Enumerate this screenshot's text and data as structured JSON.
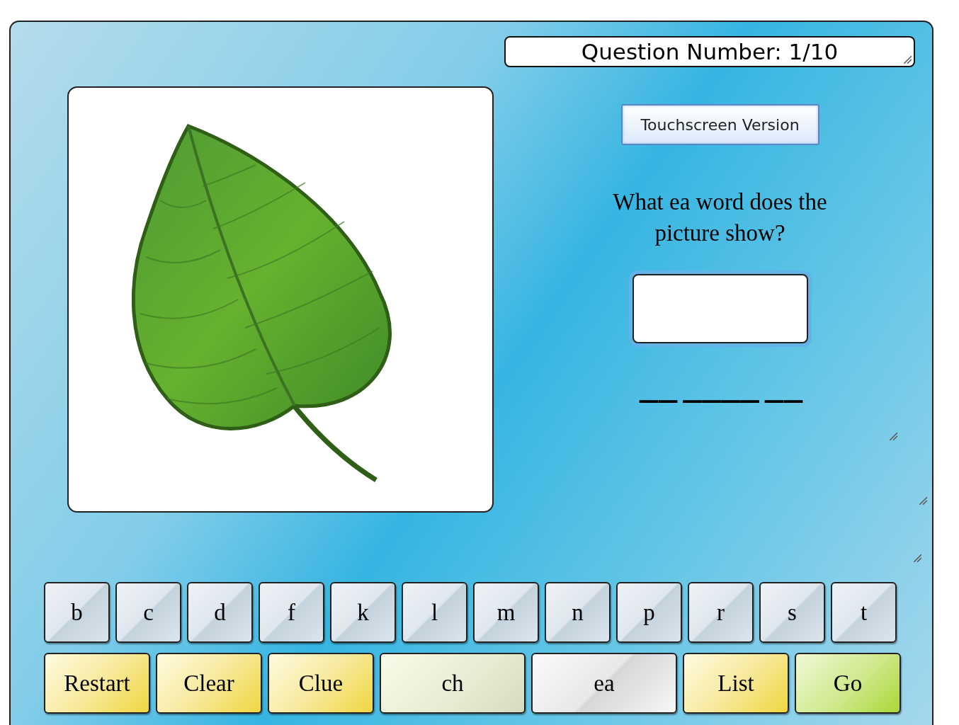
{
  "question_number": "Question Number: 1/10",
  "touchscreen_button": "Touchscreen Version",
  "prompt": "What ea word does the picture show?",
  "word_blanks": "—— ———— ——",
  "letter_keys": [
    "b",
    "c",
    "d",
    "f",
    "k",
    "l",
    "m",
    "n",
    "p",
    "r",
    "s",
    "t"
  ],
  "action_keys": [
    {
      "label": "Restart",
      "kind": "control"
    },
    {
      "label": "Clear",
      "kind": "control"
    },
    {
      "label": "Clue",
      "kind": "control"
    },
    {
      "label": "ch",
      "kind": "blend",
      "selected": false
    },
    {
      "label": "ea",
      "kind": "blend",
      "selected": true
    },
    {
      "label": "List",
      "kind": "control"
    },
    {
      "label": "Go",
      "kind": "go"
    }
  ]
}
